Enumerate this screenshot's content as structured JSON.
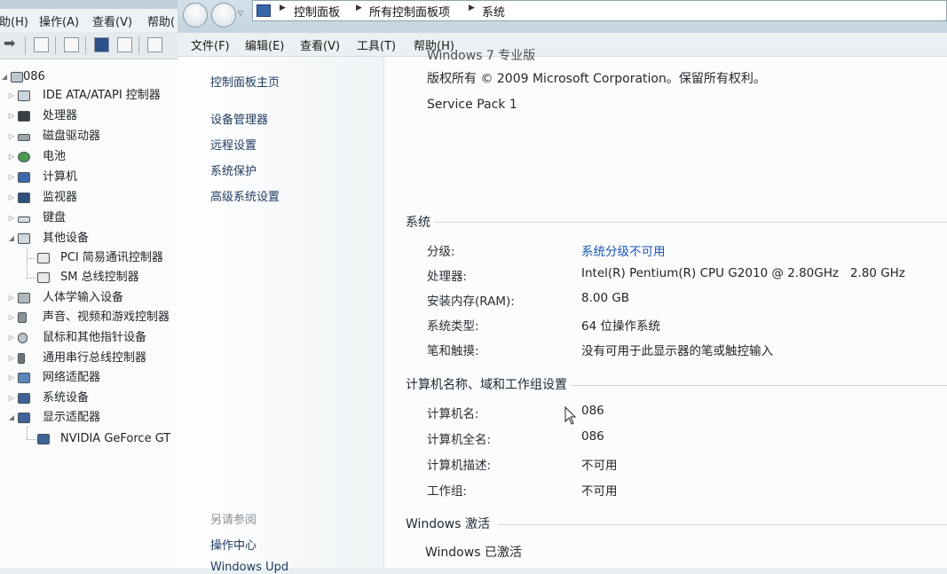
{
  "device_manager": {
    "menu": [
      "帮助(H)",
      "操作(A)",
      "查看(V)",
      "帮助("
    ],
    "root": "086",
    "categories": [
      {
        "label": "IDE ATA/ATAPI 控制器",
        "expanded": false
      },
      {
        "label": "处理器",
        "expanded": false
      },
      {
        "label": "磁盘驱动器",
        "expanded": false
      },
      {
        "label": "电池",
        "expanded": false
      },
      {
        "label": "计算机",
        "expanded": false
      },
      {
        "label": "监视器",
        "expanded": false
      },
      {
        "label": "键盘",
        "expanded": false
      },
      {
        "label": "其他设备",
        "expanded": true
      },
      {
        "label": "PCI 简易通讯控制器",
        "child": true
      },
      {
        "label": "SM 总线控制器",
        "child": true
      },
      {
        "label": "人体学输入设备",
        "expanded": false
      },
      {
        "label": "声音、视频和游戏控制器",
        "expanded": false
      },
      {
        "label": "鼠标和其他指针设备",
        "expanded": false
      },
      {
        "label": "通用串行总线控制器",
        "expanded": false
      },
      {
        "label": "网络适配器",
        "expanded": false
      },
      {
        "label": "系统设备",
        "expanded": false
      },
      {
        "label": "显示适配器",
        "expanded": true
      },
      {
        "label": "NVIDIA GeForce GT",
        "child": true
      }
    ]
  },
  "system_window": {
    "breadcrumb": [
      "控制面板",
      "所有控制面板项",
      "系统"
    ],
    "menu": [
      "文件(F)",
      "编辑(E)",
      "查看(V)",
      "工具(T)",
      "帮助(H)"
    ],
    "nav": {
      "home": "控制面板主页",
      "links": [
        "设备管理器",
        "远程设置",
        "系统保护",
        "高级系统设置"
      ],
      "see_also_heading": "另请参阅",
      "see_also": [
        "操作中心",
        "Windows Upd"
      ]
    },
    "edition": {
      "partial_title": "Windows 7 专业版",
      "copyright": "版权所有 © 2009 Microsoft Corporation。保留所有权利。",
      "service_pack": "Service Pack 1"
    },
    "system_section": {
      "heading": "系统",
      "rows": [
        {
          "label": "分级:",
          "value": "系统分级不可用",
          "link": true
        },
        {
          "label": "处理器:",
          "value": "Intel(R) Pentium(R) CPU G2010 @ 2.80GHz   2.80 GHz"
        },
        {
          "label": "安装内存(RAM):",
          "value": "8.00 GB"
        },
        {
          "label": "系统类型:",
          "value": "64 位操作系统"
        },
        {
          "label": "笔和触摸:",
          "value": "没有可用于此显示器的笔或触控输入"
        }
      ]
    },
    "computer_section": {
      "heading": "计算机名称、域和工作组设置",
      "rows": [
        {
          "label": "计算机名:",
          "value": "086"
        },
        {
          "label": "计算机全名:",
          "value": "086"
        },
        {
          "label": "计算机描述:",
          "value": "不可用"
        },
        {
          "label": "工作组:",
          "value": "不可用"
        }
      ]
    },
    "activation_section": {
      "heading": "Windows 激活",
      "status": "Windows 已激活"
    }
  }
}
